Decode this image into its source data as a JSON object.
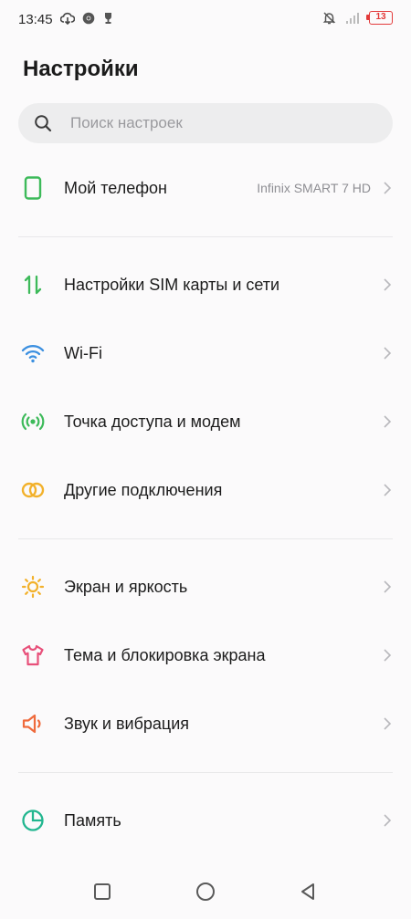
{
  "status_bar": {
    "time": "13:45",
    "battery_level": "13",
    "icons": [
      "cloud-download-icon",
      "chrome-icon",
      "trophy-icon",
      "bell-off-icon",
      "signal-icon",
      "battery-icon"
    ]
  },
  "header": {
    "title": "Настройки"
  },
  "search": {
    "placeholder": "Поиск настроек"
  },
  "settings": {
    "items": [
      {
        "label": "Мой телефон",
        "value": "Infinix SMART 7 HD",
        "icon": "phone-icon",
        "color": "#3dba5a"
      },
      {
        "label": "Настройки SIM карты и сети",
        "icon": "sim-arrows-icon",
        "color": "#3dba5a"
      },
      {
        "label": "Wi-Fi",
        "icon": "wifi-icon",
        "color": "#3b8fe0"
      },
      {
        "label": "Точка доступа и модем",
        "icon": "hotspot-icon",
        "color": "#3dba5a"
      },
      {
        "label": "Другие подключения",
        "icon": "linked-rings-icon",
        "color": "#f2b12b"
      },
      {
        "label": "Экран и яркость",
        "icon": "sun-icon",
        "color": "#f2b12b"
      },
      {
        "label": "Тема и блокировка экрана",
        "icon": "shirt-icon",
        "color": "#e8507a"
      },
      {
        "label": "Звук и вибрация",
        "icon": "speaker-icon",
        "color": "#ef6a3c"
      },
      {
        "label": "Память",
        "icon": "pie-chart-icon",
        "color": "#22b68f"
      }
    ]
  },
  "nav_bar": {
    "buttons": [
      "recents-button",
      "home-button",
      "back-button"
    ]
  }
}
